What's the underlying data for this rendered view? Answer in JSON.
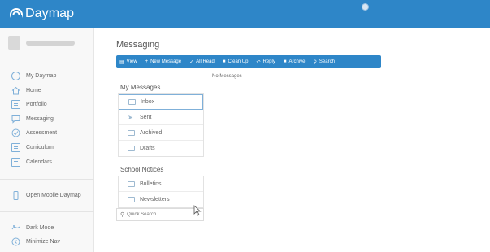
{
  "app": {
    "logo_text": "Daymap"
  },
  "sidebar": {
    "items": [
      {
        "label": "My Daymap",
        "icon": "user-circle-icon"
      },
      {
        "label": "Home",
        "icon": "home-icon"
      },
      {
        "label": "Portfolio",
        "icon": "portfolio-icon"
      },
      {
        "label": "Messaging",
        "icon": "message-icon"
      },
      {
        "label": "Assessment",
        "icon": "assessment-icon"
      },
      {
        "label": "Curriculum",
        "icon": "curriculum-icon"
      },
      {
        "label": "Calendars",
        "icon": "calendar-icon"
      }
    ],
    "mobile_label": "Open Mobile Daymap",
    "dark_mode_label": "Dark Mode",
    "minimize_label": "Minimize Nav"
  },
  "main": {
    "title": "Messaging",
    "toolbar": {
      "view": "View",
      "new_message": "New Message",
      "all_read": "All Read",
      "clean_up": "Clean Up",
      "reply": "Reply",
      "archive": "Archive",
      "search": "Search"
    },
    "empty_text": "No Messages",
    "my_messages_heading": "My Messages",
    "folders": [
      "Inbox",
      "Sent",
      "Archived",
      "Drafts"
    ],
    "school_notices_heading": "School Notices",
    "notices": [
      "Bulletins",
      "Newsletters"
    ],
    "quick_search_placeholder": "Quick Search"
  },
  "colors": {
    "accent": "#2e86c8",
    "sidebar_bg": "#f8f8f8"
  }
}
